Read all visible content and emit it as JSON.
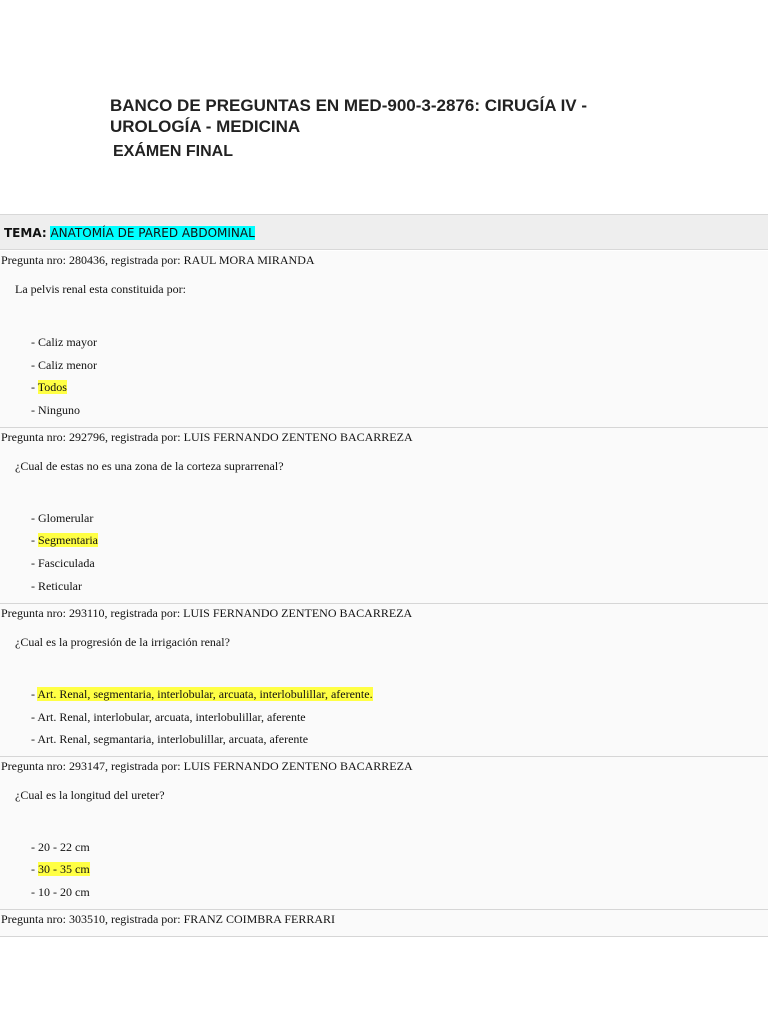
{
  "header": {
    "title": "BANCO DE PREGUNTAS EN MED-900-3-2876: CIRUGÍA IV - UROLOGÍA - MEDICINA",
    "subtitle": "EXÁMEN FINAL"
  },
  "tema": {
    "label": "TEMA:",
    "value": "ANATOMÍA DE PARED ABDOMINAL"
  },
  "questions": [
    {
      "header": "Pregunta nro: 280436, registrada por: RAUL MORA MIRANDA",
      "text": "La pelvis renal esta constituida por:",
      "options": [
        {
          "prefix": "- ",
          "text": "Caliz mayor",
          "correct": false
        },
        {
          "prefix": "- ",
          "text": "Caliz menor",
          "correct": false
        },
        {
          "prefix": "- ",
          "text": "Todos",
          "correct": true
        },
        {
          "prefix": "- ",
          "text": "Ninguno",
          "correct": false
        }
      ]
    },
    {
      "header": "Pregunta nro: 292796, registrada por: LUIS FERNANDO ZENTENO BACARREZA",
      "text": "¿Cual de estas no es una zona de la corteza suprarrenal?",
      "options": [
        {
          "prefix": "- ",
          "text": "Glomerular",
          "correct": false
        },
        {
          "prefix": "- ",
          "text": "Segmentaria",
          "correct": true
        },
        {
          "prefix": "- ",
          "text": "Fasciculada",
          "correct": false
        },
        {
          "prefix": "- ",
          "text": "Reticular",
          "correct": false
        }
      ]
    },
    {
      "header": "Pregunta nro: 293110, registrada por: LUIS FERNANDO ZENTENO BACARREZA",
      "text": "¿Cual es la progresión de la irrigación renal?",
      "options": [
        {
          "prefix": "- ",
          "text": "Art. Renal, segmentaria, interlobular, arcuata, interlobulillar, aferente.",
          "correct": true
        },
        {
          "prefix": "- ",
          "text": "Art. Renal, interlobular, arcuata, interlobulillar, aferente",
          "correct": false
        },
        {
          "prefix": "- ",
          "text": "Art. Renal, segmantaria, interlobulillar, arcuata, aferente",
          "correct": false
        }
      ]
    },
    {
      "header": "Pregunta nro: 293147, registrada por: LUIS FERNANDO ZENTENO BACARREZA",
      "text": "¿Cual es la longitud del ureter?",
      "options": [
        {
          "prefix": "- ",
          "text": "20 - 22 cm",
          "correct": false
        },
        {
          "prefix": "- ",
          "text": "30 - 35 cm",
          "correct": true
        },
        {
          "prefix": "- ",
          "text": "10 - 20 cm",
          "correct": false
        }
      ]
    },
    {
      "header": "Pregunta nro: 303510, registrada por: FRANZ COIMBRA FERRARI",
      "text": "",
      "options": []
    }
  ]
}
